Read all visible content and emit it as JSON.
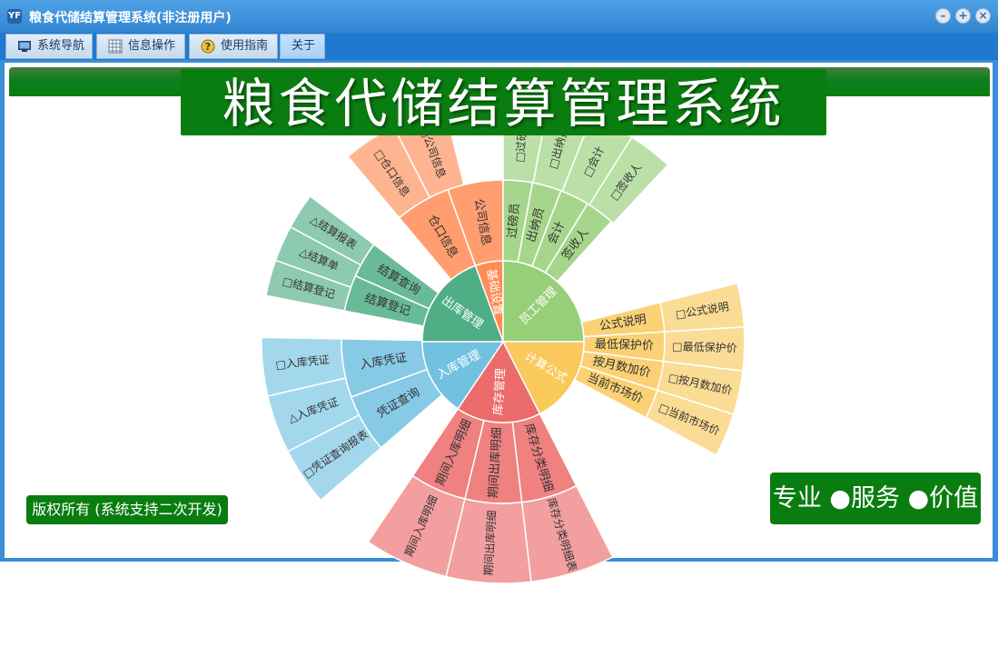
{
  "window": {
    "title": "粮食代储结算管理系统(非注册用户)",
    "controls": [
      "minimize",
      "restore",
      "close"
    ]
  },
  "menu": {
    "tabs": [
      {
        "label": "系统导航",
        "icon": "monitor-icon"
      },
      {
        "label": "信息操作",
        "icon": "grid-icon"
      },
      {
        "label": "使用指南",
        "icon": "help-icon"
      },
      {
        "label": "关于",
        "icon": ""
      }
    ]
  },
  "banner": {
    "title": "粮食代储结算管理系统"
  },
  "footer": {
    "copyright": "版权所有 (系统支持二次开发)",
    "slogan": "专业 ●服务 ●价值"
  },
  "colors": {
    "title_bar": "#3a8ed8",
    "menu_bar": "#1e79cf",
    "banner_green": "#0a7d10",
    "basic": "#ff8c55",
    "staff": "#96cf78",
    "formula": "#f9c95b",
    "stock": "#ec6b6b",
    "inbound": "#72c1e0",
    "outbound": "#4fae85"
  },
  "sunburst": {
    "center": [
      {
        "id": "basic",
        "label": "基础设置"
      },
      {
        "id": "staff",
        "label": "员工管理"
      },
      {
        "id": "formula",
        "label": "计算公式"
      },
      {
        "id": "stock",
        "label": "库存管理"
      },
      {
        "id": "inbound",
        "label": "入库管理"
      },
      {
        "id": "outbound",
        "label": "出库管理"
      }
    ],
    "middle": {
      "basic": [
        "仓口信息",
        "公司信息"
      ],
      "staff": [
        "过磅员",
        "出纳员",
        "会计",
        "签收人"
      ],
      "formula": [
        "公式说明",
        "最低保护价",
        "按月数加价",
        "当前市场价"
      ],
      "stock": [
        "库存分类明细",
        "期间出库明细",
        "期间入库明细"
      ],
      "inbound": [
        "凭证查询",
        "入库凭证"
      ],
      "outbound": [
        "结算登记",
        "结算查询"
      ]
    },
    "outer": {
      "basic": [
        "□仓口信息",
        "□公司信息"
      ],
      "staff": [
        "□过磅员",
        "□出纳员",
        "□会计",
        "□签收人"
      ],
      "formula": [
        "□公式说明",
        "□最低保护价",
        "□按月数加价",
        "□当前市场价"
      ],
      "stock": [
        "库存分类明细表",
        "期间出库明细",
        "期间入库明细"
      ],
      "inbound": [
        "□凭证查询报表",
        "△入库凭证",
        "□入库凭证"
      ],
      "outbound": [
        "□结算登记",
        "△结算单",
        "△结算报表"
      ]
    }
  }
}
